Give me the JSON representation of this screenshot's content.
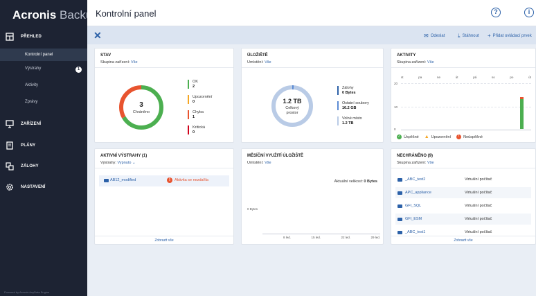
{
  "sidebar": {
    "logo_bold": "Acronis",
    "logo_light": "Backup",
    "nav": [
      {
        "label": "PŘEHLED"
      },
      {
        "label": "ZAŘÍZENÍ"
      },
      {
        "label": "PLÁNY"
      },
      {
        "label": "ZÁLOHY"
      },
      {
        "label": "NASTAVENÍ"
      }
    ],
    "sub": [
      {
        "label": "Kontrolní panel"
      },
      {
        "label": "Výstrahy",
        "badge": "1"
      },
      {
        "label": "Aktivity"
      },
      {
        "label": "Zprávy"
      }
    ],
    "powered": "Powered by Acronis AnyData Engine"
  },
  "header": {
    "title": "Kontrolní panel",
    "help_glyph": "?",
    "account_glyph": "i"
  },
  "toolbar": {
    "send": "Odeslat",
    "download": "Stáhnout",
    "add_widget": "Přidat ovládací prvek"
  },
  "widgets": {
    "stav": {
      "title": "STAV",
      "group_label": "Skupina zařízení:",
      "group_value": "Vše",
      "donut_value": "3",
      "donut_label": "Chráněno",
      "legend": [
        {
          "label": "OK",
          "value": "2",
          "color": "#4caf50"
        },
        {
          "label": "Upozornění",
          "value": "0",
          "color": "#f5a623"
        },
        {
          "label": "Chyba",
          "value": "1",
          "color": "#e8542f"
        },
        {
          "label": "Kritická",
          "value": "0",
          "color": "#d0021b"
        }
      ],
      "segments": [
        {
          "value": 2,
          "color": "#4caf50"
        },
        {
          "value": 1,
          "color": "#e8542f"
        }
      ]
    },
    "uloziste": {
      "title": "ÚLOŽIŠTĚ",
      "location_label": "Umístění:",
      "location_value": "Vše",
      "donut_value": "1.2 TB",
      "donut_label_1": "Celkový",
      "donut_label_2": "prostor",
      "legend": [
        {
          "label": "Zálohy",
          "value": "0 Bytes",
          "color": "#2c61a8"
        },
        {
          "label": "Ostatní soubory",
          "value": "16.2 GB",
          "color": "#5b8bd4"
        },
        {
          "label": "Volné místo",
          "value": "1.2 TB",
          "color": "#b9cbe6"
        }
      ]
    },
    "aktivity": {
      "title": "AKTIVITY",
      "group_label": "Skupina zařízení:",
      "group_value": "Vše",
      "y_ticks": [
        "20",
        "10",
        "0"
      ],
      "days": [
        "st",
        "pa",
        "ne",
        "út",
        "pá",
        "so",
        "po",
        "út"
      ],
      "legend": [
        {
          "label": "Úspěšné",
          "color": "#4caf50",
          "glyph": "✓"
        },
        {
          "label": "Upozornění",
          "color": "#f5a623",
          "glyph": "!"
        },
        {
          "label": "Neúspěšné",
          "color": "#e8542f",
          "glyph": "!"
        }
      ],
      "last_bar": {
        "success": 15,
        "failed": 1
      }
    },
    "vystrahy": {
      "title": "AKTIVNÍ VÝSTRAHY (1)",
      "filter_label": "Výstrahy:",
      "filter_value": "Vypnuto",
      "alert_device": "AB12_modified",
      "alert_text": "Aktivita se nezdařila",
      "footer": "Zobrazit vše"
    },
    "mesicni": {
      "title": "MĚSÍČNÍ VYUŽITÍ ÚLOŽIŠTĚ",
      "location_label": "Umístění:",
      "location_value": "Vše",
      "current_label": "Aktuální velikost:",
      "current_value": "0 Bytes",
      "y_label": "0 Bytes",
      "x_ticks": [
        "8 led.",
        "15 led.",
        "22 led.",
        "29 led."
      ]
    },
    "nechraneno": {
      "title": "NECHRÁNĚNO (9)",
      "group_label": "Skupina zařízení:",
      "group_value": "Vše",
      "rows": [
        {
          "name": "_ABC_test2",
          "type": "Virtuální počítač"
        },
        {
          "name": "APC_appliance",
          "type": "Virtuální počítač"
        },
        {
          "name": "GFI_SQL",
          "type": "Virtuální počítač"
        },
        {
          "name": "GFI_ESM",
          "type": "Virtuální počítač"
        },
        {
          "name": "_ABC_test1",
          "type": "Virtuální počítač"
        }
      ],
      "footer": "Zobrazit vše"
    }
  }
}
